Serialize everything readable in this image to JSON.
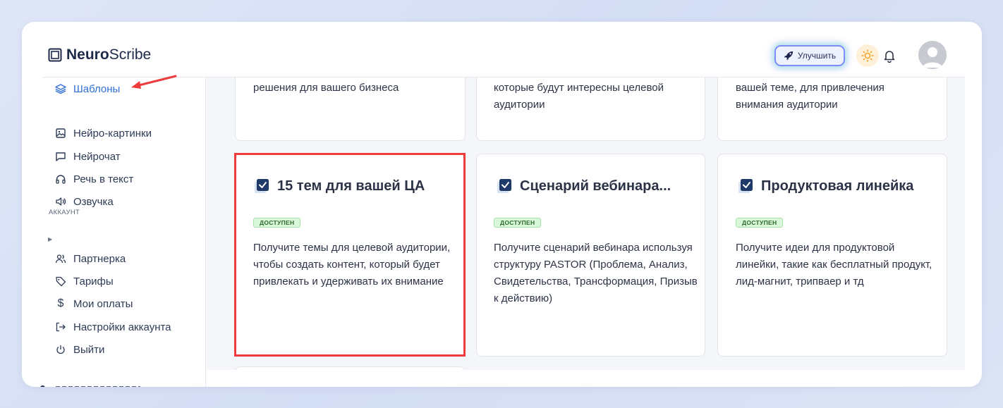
{
  "app": {
    "logo_bold": "Neuro",
    "logo_light": "Scribe"
  },
  "header": {
    "upgrade_label": "Улучшить"
  },
  "sidebar": {
    "items_top": [
      {
        "label": "Шаблоны",
        "icon": "layers-icon",
        "active": true
      },
      {
        "label": "Нейро-картинки",
        "icon": "image-icon"
      },
      {
        "label": "Нейрочат",
        "icon": "chat-icon"
      },
      {
        "label": "Речь в текст",
        "icon": "headphones-icon"
      },
      {
        "label": "Озвучка",
        "icon": "speaker-icon"
      }
    ],
    "section_label": "АККАУНТ",
    "items_account": [
      {
        "label": "Партнерка",
        "icon": "users-icon"
      },
      {
        "label": "Тарифы",
        "icon": "tag-icon"
      },
      {
        "label": "Мои оплаты",
        "icon": "dollar-icon"
      },
      {
        "label": "Настройки аккаунта",
        "icon": "logout-arrow-icon"
      },
      {
        "label": "Выйти",
        "icon": "power-icon"
      }
    ]
  },
  "cards_top": [
    {
      "text": "решения для вашего бизнеса"
    },
    {
      "text": "которые будут интересны целевой аудитории"
    },
    {
      "text": "вашей теме, для привлечения внимания аудитории"
    }
  ],
  "cards": [
    {
      "title": "15 тем для вашей ЦА",
      "badge": "ДОСТУПЕН",
      "desc": "Получите темы для целевой аудитории, чтобы создать контент, который будет привлекать и удерживать их внимание"
    },
    {
      "title": "Сценарий вебинара...",
      "badge": "ДОСТУПЕН",
      "desc": "Получите сценарий вебинара используя структуру PASTOR (Проблема, Анализ, Свидетельства, Трансформация, Призыв к действию)"
    },
    {
      "title": "Продуктовая линейка",
      "badge": "ДОСТУПЕН",
      "desc": "Получите идеи для продуктовой линейки, такие как бесплатный продукт, лид-магнит, трипваер и тд"
    }
  ],
  "colors": {
    "accent": "#2f6fd6",
    "highlight": "#ee3b3b",
    "badge_bg": "#d9f7d9",
    "checkbox": "#1f3a68"
  }
}
